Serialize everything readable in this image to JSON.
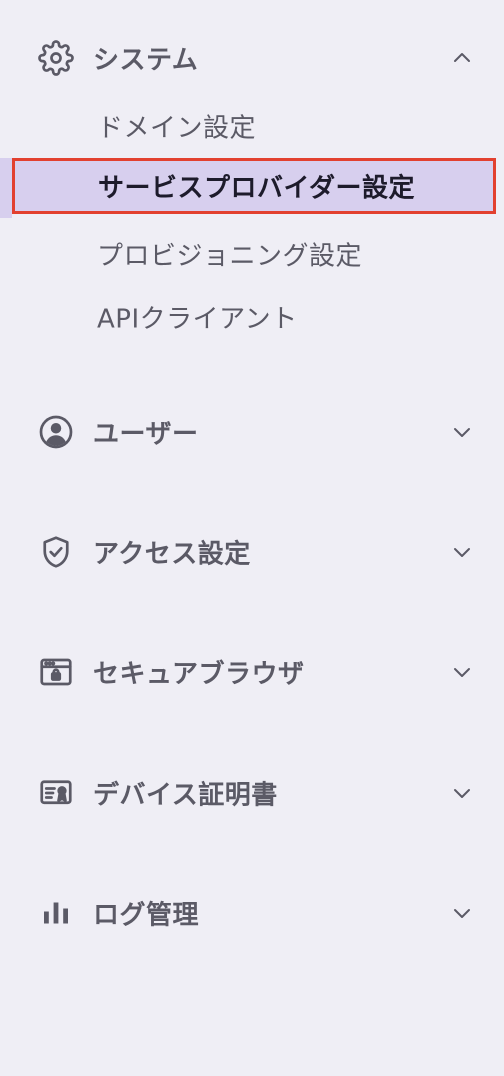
{
  "sections": {
    "system": {
      "label": "システム",
      "icon": "gear-icon",
      "expanded": true,
      "items": [
        {
          "label": "ドメイン設定"
        },
        {
          "label": "サービスプロバイダー設定",
          "active": true
        },
        {
          "label": "プロビジョニング設定"
        },
        {
          "label": "APIクライアント"
        }
      ]
    },
    "users": {
      "label": "ユーザー",
      "icon": "user-circle-icon",
      "expanded": false
    },
    "access": {
      "label": "アクセス設定",
      "icon": "shield-check-icon",
      "expanded": false
    },
    "browser": {
      "label": "セキュアブラウザ",
      "icon": "browser-lock-icon",
      "expanded": false
    },
    "certs": {
      "label": "デバイス証明書",
      "icon": "certificate-icon",
      "expanded": false
    },
    "logs": {
      "label": "ログ管理",
      "icon": "bar-chart-icon",
      "expanded": false
    }
  },
  "colors": {
    "background": "#efeef5",
    "text": "#5b5a66",
    "active_background": "#d7cfee",
    "active_text": "#1d1b2b",
    "highlight_border": "#e2402f"
  }
}
